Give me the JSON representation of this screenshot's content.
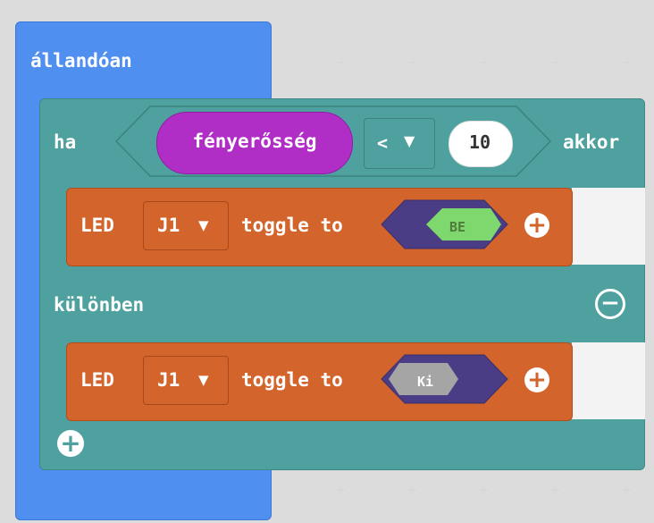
{
  "forever": {
    "label": "állandóan"
  },
  "if_block": {
    "if_label": "ha",
    "then_label": "akkor",
    "else_label": "különben",
    "condition": {
      "sensor": "fényerősség",
      "operator": "<",
      "value": "10"
    }
  },
  "then_statement": {
    "led_label": "LED",
    "pin": "J1",
    "toggle_label": "toggle to",
    "state": "BE",
    "state_color": "#7fd86e"
  },
  "else_statement": {
    "led_label": "LED",
    "pin": "J1",
    "toggle_label": "toggle to",
    "state": "Ki",
    "state_color": "#a5a5a5"
  },
  "colors": {
    "forever": "#4f8ff0",
    "logic": "#4fa19f",
    "sensor": "#b02ec6",
    "led": "#d3642b",
    "toggle_socket": "#4a3d86"
  }
}
